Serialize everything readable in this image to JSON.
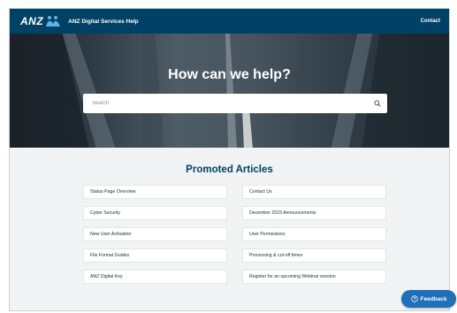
{
  "header": {
    "logo": "ANZ",
    "site_title": "ANZ Digital Services Help",
    "contact_label": "Contact"
  },
  "hero": {
    "title": "How can we help?",
    "search_placeholder": "Search"
  },
  "promoted": {
    "title": "Promoted Articles",
    "left": [
      "Status Page Overview",
      "Cyber Security",
      "New User Activation",
      "File Format Guides",
      "ANZ Digital Key"
    ],
    "right": [
      "Contact Us",
      "December 2023 Announcements",
      "User Permissions",
      "Processing & cut-off times",
      "Register for an upcoming Webinar session"
    ]
  },
  "feedback_label": "Feedback",
  "icons": {
    "logo": "anz-people-icon",
    "search": "search-icon",
    "feedback": "help-circle-icon"
  },
  "colors": {
    "brand": "#004165",
    "feedback": "#1f6fb9"
  }
}
